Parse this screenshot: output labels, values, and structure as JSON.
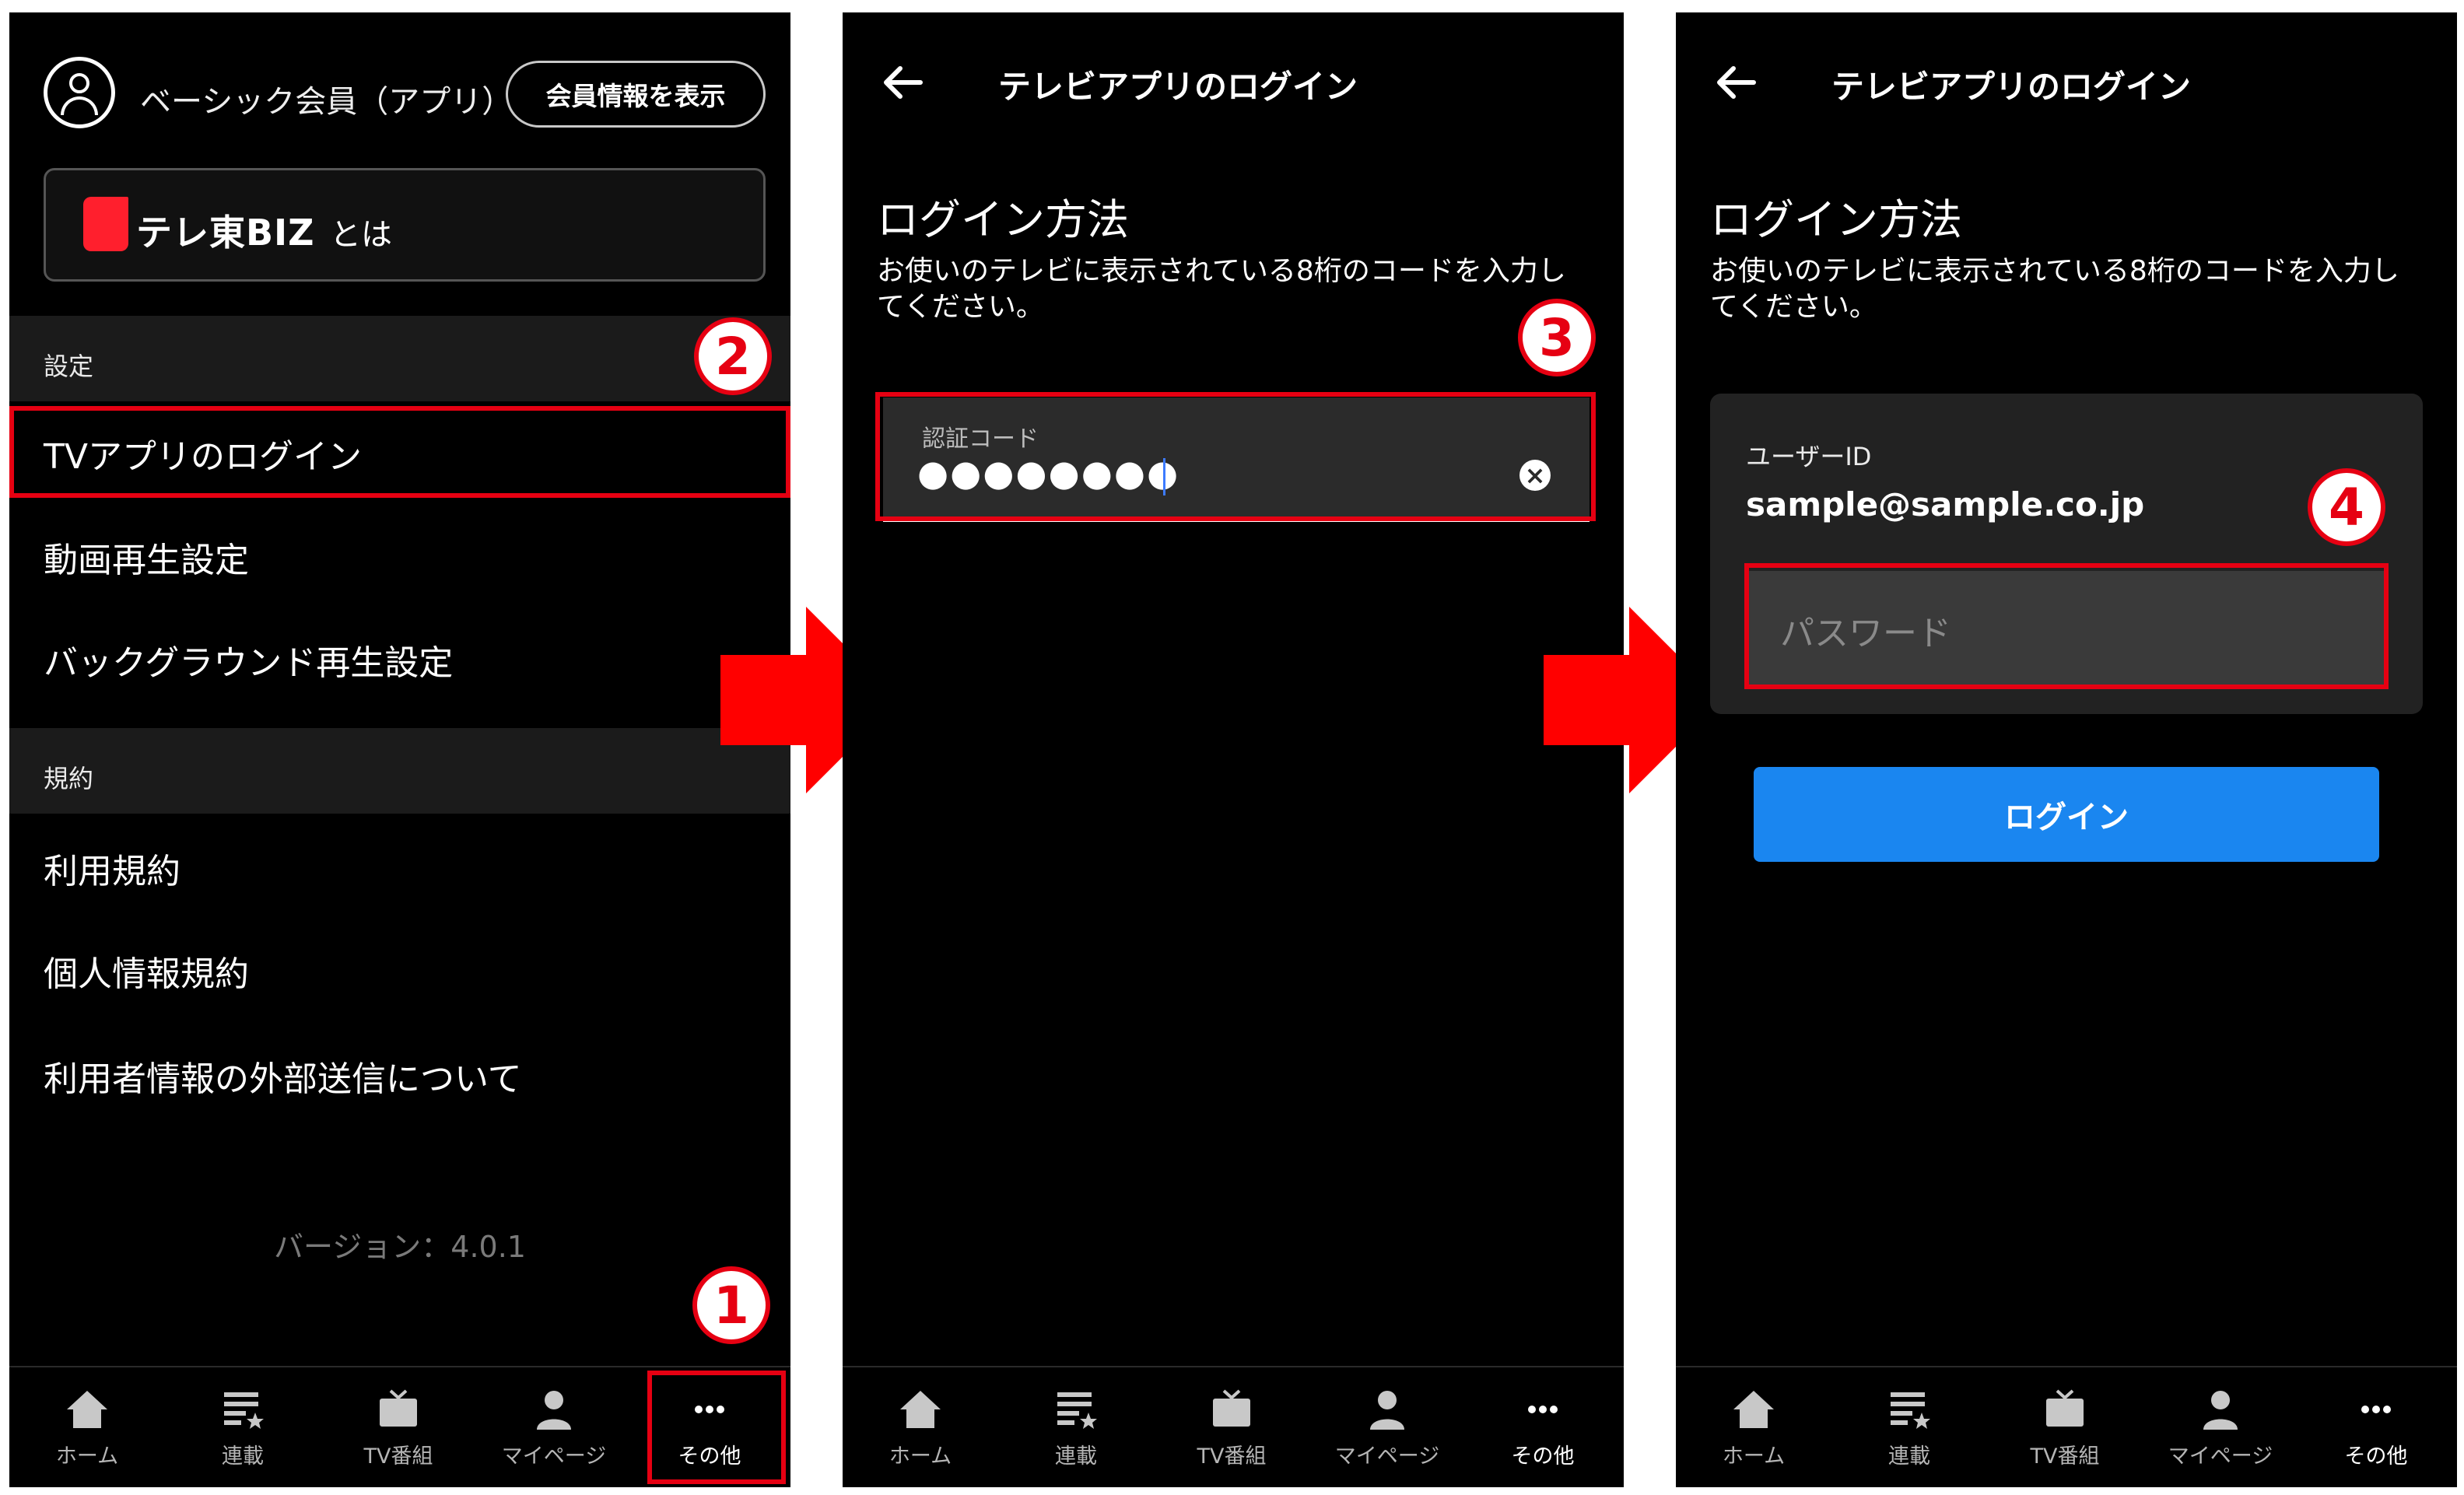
{
  "panel1": {
    "account_label": "ベーシック会員（アプリ）",
    "member_info_button": "会員情報を表示",
    "biz_brand": "テレ東BIZ",
    "biz_about_suffix": "とは",
    "settings_header": "設定",
    "settings_items": [
      "TVアプリのログイン",
      "動画再生設定",
      "バックグラウンド再生設定"
    ],
    "terms_header": "規約",
    "terms_items": [
      "利用規約",
      "個人情報規約",
      "利用者情報の外部送信について"
    ],
    "version": "バージョン：4.0.1",
    "step_badges": [
      "1",
      "2"
    ]
  },
  "panel2": {
    "title": "テレビアプリのログイン",
    "section_title": "ログイン方法",
    "description": "お使いのテレビに表示されている8桁のコードを入力してください。",
    "code_label": "認証コード",
    "code_value": "●●●●●●●●",
    "step_badge": "3"
  },
  "panel3": {
    "title": "テレビアプリのログイン",
    "section_title": "ログイン方法",
    "description": "お使いのテレビに表示されている8桁のコードを入力してください。",
    "user_id_label": "ユーザーID",
    "user_id_value": "sample@sample.co.jp",
    "password_placeholder": "パスワード",
    "login_button": "ログイン",
    "step_badge": "4"
  },
  "tabbar": {
    "tabs": [
      {
        "label": "ホーム",
        "icon": "home-icon"
      },
      {
        "label": "連載",
        "icon": "series-icon"
      },
      {
        "label": "TV番組",
        "icon": "tv-icon"
      },
      {
        "label": "マイページ",
        "icon": "person-icon"
      },
      {
        "label": "その他",
        "icon": "more-icon"
      }
    ],
    "active_index": 4
  },
  "colors": {
    "background": "#000000",
    "highlight_red": "#e60012",
    "login_button_blue": "#1a86f0",
    "arrow_red": "#ff0000"
  }
}
